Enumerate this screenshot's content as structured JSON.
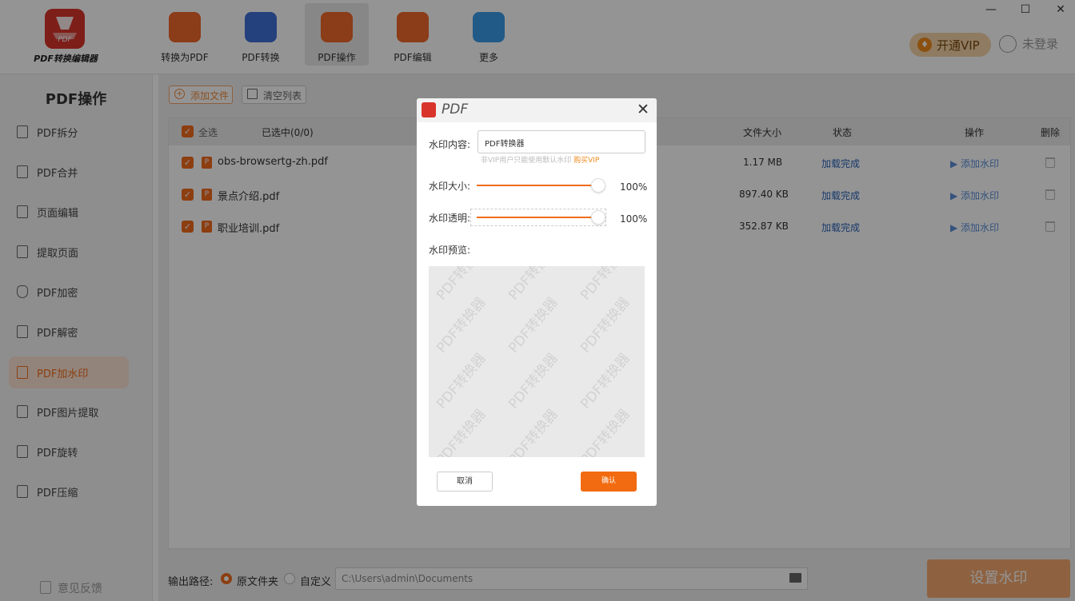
{
  "app": {
    "logo_text": "PDF",
    "name": "PDF转换编辑器"
  },
  "window": {
    "minimize": "—",
    "maximize": "☐",
    "close": "✕"
  },
  "nav": [
    {
      "label": "转换为PDF",
      "color": "#f0682a",
      "icon": "convert-to-pdf-icon",
      "active": false
    },
    {
      "label": "PDF转换",
      "color": "#3f6fd8",
      "icon": "pdf-convert-icon",
      "active": false
    },
    {
      "label": "PDF操作",
      "color": "#f0682a",
      "icon": "pdf-operation-icon",
      "active": true
    },
    {
      "label": "PDF编辑",
      "color": "#f0682a",
      "icon": "pdf-edit-icon",
      "active": false
    },
    {
      "label": "更多",
      "color": "#3a9be8",
      "icon": "more-grid-icon",
      "active": false
    }
  ],
  "header": {
    "vip_label": "开通VIP",
    "login_label": "未登录"
  },
  "sidebar": {
    "title": "PDF操作",
    "items": [
      {
        "label": "PDF拆分"
      },
      {
        "label": "PDF合并"
      },
      {
        "label": "页面编辑"
      },
      {
        "label": "提取页面"
      },
      {
        "label": "PDF加密"
      },
      {
        "label": "PDF解密"
      },
      {
        "label": "PDF加水印",
        "active": true
      },
      {
        "label": "PDF图片提取"
      },
      {
        "label": "PDF旋转"
      },
      {
        "label": "PDF压缩"
      }
    ],
    "feedback": "意见反馈"
  },
  "toolbar": {
    "add_file": "添加文件",
    "clear_list": "清空列表"
  },
  "table": {
    "select_all": "全选",
    "selected_count": "已选中(0/0)",
    "headers": {
      "size": "文件大小",
      "status": "状态",
      "action": "操作",
      "delete": "删除"
    },
    "rows": [
      {
        "name": "obs-browsertg-zh.pdf",
        "size": "1.17 MB",
        "status": "加载完成",
        "action": "添加水印"
      },
      {
        "name": "景点介绍.pdf",
        "size": "897.40 KB",
        "status": "加载完成",
        "action": "添加水印"
      },
      {
        "name": "职业培训.pdf",
        "size": "352.87 KB",
        "status": "加载完成",
        "action": "添加水印"
      }
    ]
  },
  "output": {
    "label": "输出路径:",
    "option_original": "原文件夹",
    "option_custom": "自定义",
    "path": "C:\\Users\\admin\\Documents",
    "selected": "原文件夹"
  },
  "set_button": "设置水印",
  "dialog": {
    "title": "PDF",
    "close": "✕",
    "content_label": "水印内容:",
    "content_value": "PDF转换器",
    "vip_hint": "非VIP用户只能使用默认水印",
    "vip_link": "购买VIP",
    "size_label": "水印大小:",
    "size_value": "100%",
    "size_level": 1.0,
    "opacity_label": "水印透明:",
    "opacity_value": "100%",
    "opacity_level": 1.0,
    "preview_label": "水印预览:",
    "preview_text": "PDF转换器",
    "cancel": "取消",
    "confirm": "确认"
  },
  "colors": {
    "accent": "#f26b1d",
    "status": "#2a62b8",
    "link": "#5a8fd8"
  }
}
